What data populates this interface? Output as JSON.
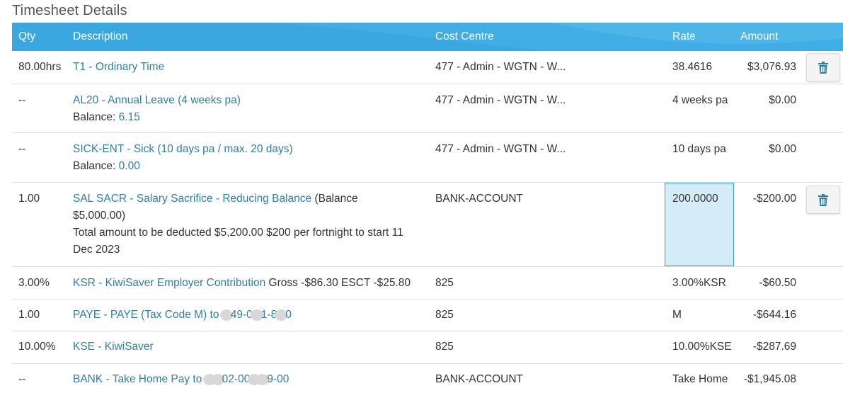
{
  "title": "Timesheet Details",
  "columns": {
    "qty": "Qty",
    "description": "Description",
    "cost_centre": "Cost Centre",
    "rate": "Rate",
    "amount": "Amount"
  },
  "colors": {
    "header_bg": "#3aa7e0",
    "link": "#2f7fa8",
    "selected_rate_bg": "#d3ecf8"
  },
  "rows": [
    {
      "qty": "80.00hrs",
      "code": "T1 - Ordinary Time",
      "cost_centre": "477 - Admin - WGTN - W...",
      "rate": "38.4616",
      "amount": "$3,076.93",
      "deletable": true
    },
    {
      "qty": "--",
      "code": "AL20 - Annual Leave (4 weeks pa)",
      "balance_label": "Balance:",
      "balance_value": "6.15",
      "cost_centre": "477 - Admin - WGTN - W...",
      "rate": "4 weeks pa",
      "amount": "$0.00"
    },
    {
      "qty": "--",
      "code": "SICK-ENT - Sick (10 days pa / max. 20 days)",
      "balance_label": "Balance:",
      "balance_value": "0.00",
      "cost_centre": "477 - Admin - WGTN - W...",
      "rate": "10 days pa",
      "amount": "$0.00"
    },
    {
      "qty": "1.00",
      "code": "SAL SACR - Salary Sacrifice - Reducing Balance",
      "extra_1": "(Balance",
      "extra_2": "$5,000.00)",
      "note_1": "Total amount to be deducted $5,200.00 $200 per fortnight to start 11",
      "note_2": "Dec 2023",
      "cost_centre": "BANK-ACCOUNT",
      "rate": "200.0000",
      "amount": "-$200.00",
      "deletable": true
    },
    {
      "qty": "3.00%",
      "code": "KSR - KiwiSaver Employer Contribution",
      "extra": "Gross -$86.30 ESCT -$25.80",
      "cost_centre": "825",
      "rate": "3.00%KSR",
      "amount": "-$60.50"
    },
    {
      "qty": "1.00",
      "code_a": "PAYE - PAYE (Tax Code M) to",
      "code_b": "49-0",
      "code_c": "1-8",
      "code_d": "0",
      "cost_centre": "825",
      "rate": "M",
      "amount": "-$644.16"
    },
    {
      "qty": "10.00%",
      "code": "KSE - KiwiSaver",
      "cost_centre": "825",
      "rate": "10.00%KSE",
      "amount": "-$287.69"
    },
    {
      "qty": "--",
      "code_a": "BANK - Take Home Pay to",
      "code_b": "02-00",
      "code_c": "9-00",
      "cost_centre": "BANK-ACCOUNT",
      "rate": "Take Home",
      "amount": "-$1,945.08"
    }
  ],
  "icons": {
    "delete": "trash-icon"
  }
}
